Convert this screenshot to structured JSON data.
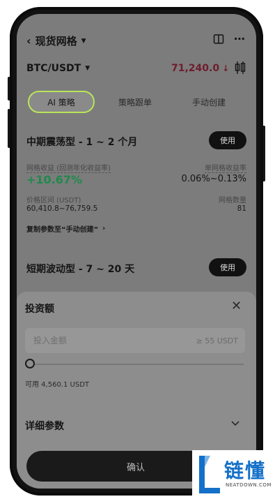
{
  "header": {
    "title": "现货网格"
  },
  "market": {
    "pair": "BTC/USDT",
    "price": "71,240.0",
    "price_color": "#6e1d2e"
  },
  "tabs": [
    {
      "label": "AI 策略",
      "active": true
    },
    {
      "label": "策略跟单",
      "active": false
    },
    {
      "label": "手动创建",
      "active": false
    }
  ],
  "strategies": [
    {
      "title": "中期震荡型 - 1 ~ 2 个月",
      "use_label": "使用",
      "return_label": "网格收益 (回测年化收益率)",
      "return_value": "+10.67%",
      "per_grid_label": "单网格收益率",
      "per_grid_value": "0.06%~0.13%",
      "range_label": "价格区间 (USDT)",
      "range_value": "60,410.8~76,759.5",
      "count_label": "网格数量",
      "count_value": "81",
      "copy_link": "复制参数至“手动创建”"
    },
    {
      "title": "短期波动型 - 7 ~ 20 天",
      "use_label": "使用"
    }
  ],
  "sheet": {
    "title": "投资额",
    "input_placeholder": "投入金额",
    "min_hint": "≥ 55 USDT",
    "available": "可用 4,560.1 USDT",
    "slider_percent": 0,
    "details_label": "详细参数",
    "confirm_label": "确认"
  },
  "watermark": {
    "text": "链懂",
    "sub": "NEATDOWN.COM",
    "color": "#1470c8"
  }
}
